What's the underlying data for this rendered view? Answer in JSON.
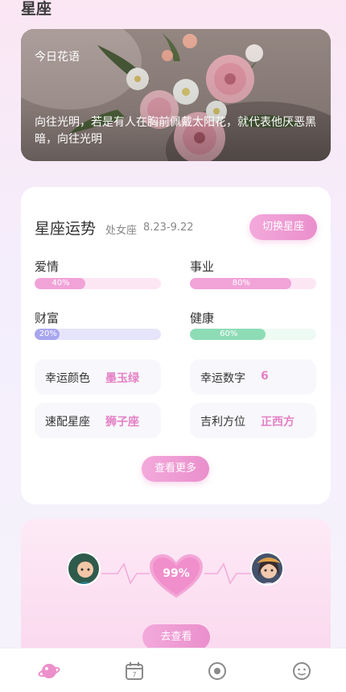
{
  "page": {
    "title": "星座"
  },
  "flower": {
    "label": "今日花语",
    "quote": "向往光明，若是有人在胸前佩戴太阳花，就代表他厌恶黑暗，向往光明"
  },
  "horoscope": {
    "title": "星座运势",
    "sign": "处女座",
    "date_range": "8.23-9.22",
    "switch_label": "切换星座",
    "metrics": [
      {
        "label": "爱情",
        "percent": 40,
        "percent_text": "40%",
        "fill_color": "#f1a3d8",
        "track_color": "#fde6f4"
      },
      {
        "label": "事业",
        "percent": 80,
        "percent_text": "80%",
        "fill_color": "#f1a3d8",
        "track_color": "#fde6f4"
      },
      {
        "label": "财富",
        "percent": 20,
        "percent_text": "20%",
        "fill_color": "#a7a6ef",
        "track_color": "#e6e4fa"
      },
      {
        "label": "健康",
        "percent": 60,
        "percent_text": "60%",
        "fill_color": "#8edcb6",
        "track_color": "#eefaf4"
      }
    ],
    "info": [
      {
        "key": "幸运颜色",
        "value": "墨玉绿"
      },
      {
        "key": "幸运数字",
        "value": "6"
      },
      {
        "key": "速配星座",
        "value": "狮子座"
      },
      {
        "key": "吉利方位",
        "value": "正西方"
      }
    ],
    "more_label": "查看更多"
  },
  "match": {
    "percent_text": "99%",
    "go_label": "去查看"
  },
  "nav": {
    "items": [
      {
        "icon": "planet-icon",
        "active": true
      },
      {
        "icon": "calendar-icon",
        "date_text": "7"
      },
      {
        "icon": "record-icon"
      },
      {
        "icon": "smile-icon"
      }
    ]
  },
  "colors": {
    "accent": "#ea8fcc",
    "accent_light": "#f3a9db",
    "value_text": "#e481c5"
  }
}
